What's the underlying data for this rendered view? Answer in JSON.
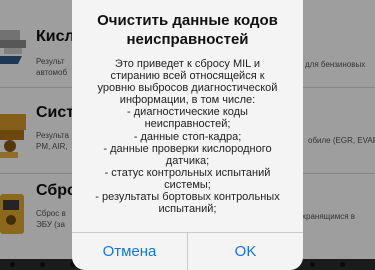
{
  "list": {
    "items": [
      {
        "title": "Кисл",
        "description_left": "Результ",
        "description_left_2": "автомоб",
        "description_right": "для бензиновых",
        "icon": "oxygen-sensor-icon"
      },
      {
        "title": "Сист",
        "description_left": "Результа",
        "description_left_2": "PM, AIR,",
        "description_right": "обиле (EGR, EVAP",
        "icon": "engine-system-icon"
      },
      {
        "title": "Сбро",
        "description_left": "Сброс в",
        "description_left_2": "ЭБУ (за",
        "description_right": "хранящимся в",
        "icon": "reset-device-icon"
      }
    ]
  },
  "alert": {
    "title_line_1": "Очистить данные кодов",
    "title_line_2": "неисправностей",
    "message_lines": [
      "Это приведет к сбросу MIL и",
      "стиранию всей относящейся к",
      "уровню выбросов диагностической",
      "информации, в том числе:",
      "- диагностические коды",
      "неисправностей;",
      "- данные стоп-кадра;",
      "- данные проверки кислородного",
      "датчика;",
      "- статус контрольных испытаний",
      "системы;",
      "- результаты бортовых контрольных",
      "испытаний;"
    ],
    "cancel_label": "Отмена",
    "ok_label": "OK",
    "accent_color": "#1476d4"
  }
}
